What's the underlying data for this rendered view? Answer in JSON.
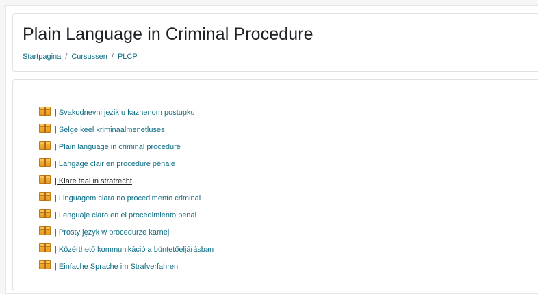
{
  "header": {
    "title": "Plain Language in Criminal Procedure",
    "breadcrumb": [
      {
        "label": "Startpagina"
      },
      {
        "label": "Cursussen"
      },
      {
        "label": "PLCP"
      }
    ],
    "separator": "/"
  },
  "courses": {
    "icon": "package-icon",
    "items": [
      {
        "label": "| Svakodnevni jezik u kaznenom postupku"
      },
      {
        "label": "| Selge keel kriminaalmenetluses"
      },
      {
        "label": "| Plain language in criminal procedure"
      },
      {
        "label": "| Langage clair en procedure pénale"
      },
      {
        "label": "| Klare taal in strafrecht",
        "hovered": true
      },
      {
        "label": "| Linguagem clara no procedimento criminal"
      },
      {
        "label": "| Lenguaje claro en el procedimiento penal"
      },
      {
        "label": "| Prosty język w procedurze karnej"
      },
      {
        "label": "| Közérthető kommunikáció a büntetőeljárásban"
      },
      {
        "label": "| Einfache Sprache im Strafverfahren"
      }
    ]
  },
  "colors": {
    "link": "#0f6e84",
    "link_hover": "#1d2125",
    "title": "#1d2125"
  }
}
